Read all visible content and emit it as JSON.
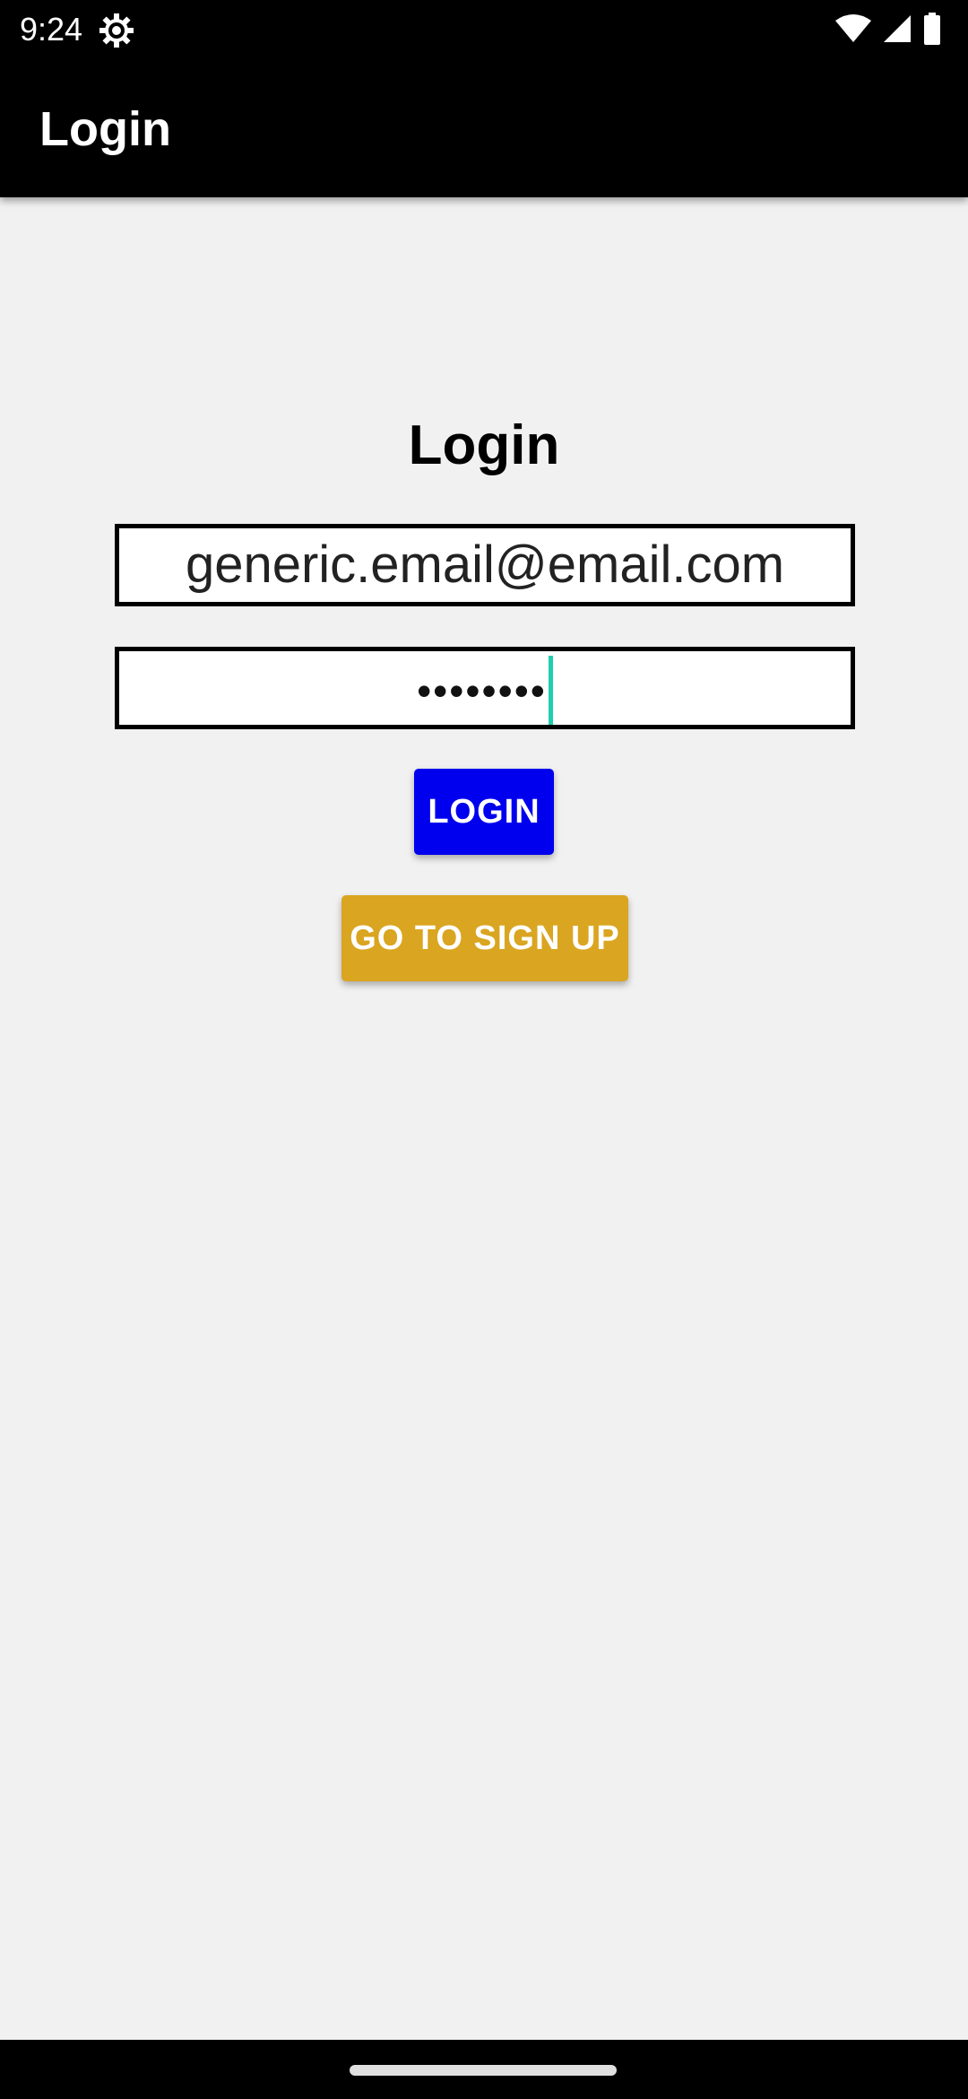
{
  "status_bar": {
    "time": "9:24",
    "icons": [
      "settings-gear-icon",
      "wifi-icon",
      "cell-signal-icon",
      "battery-icon"
    ]
  },
  "app_bar": {
    "title": "Login"
  },
  "form": {
    "title": "Login",
    "email": {
      "value": "generic.email@email.com"
    },
    "password": {
      "masked_value": "••••••••"
    },
    "login_button_label": "LOGIN",
    "signup_button_label": "GO TO SIGN UP"
  },
  "colors": {
    "app_bar": "#000000",
    "background": "#f1f1f1",
    "login_button": "#0000ee",
    "signup_button": "#daa520",
    "caret": "#1fcfb0"
  }
}
